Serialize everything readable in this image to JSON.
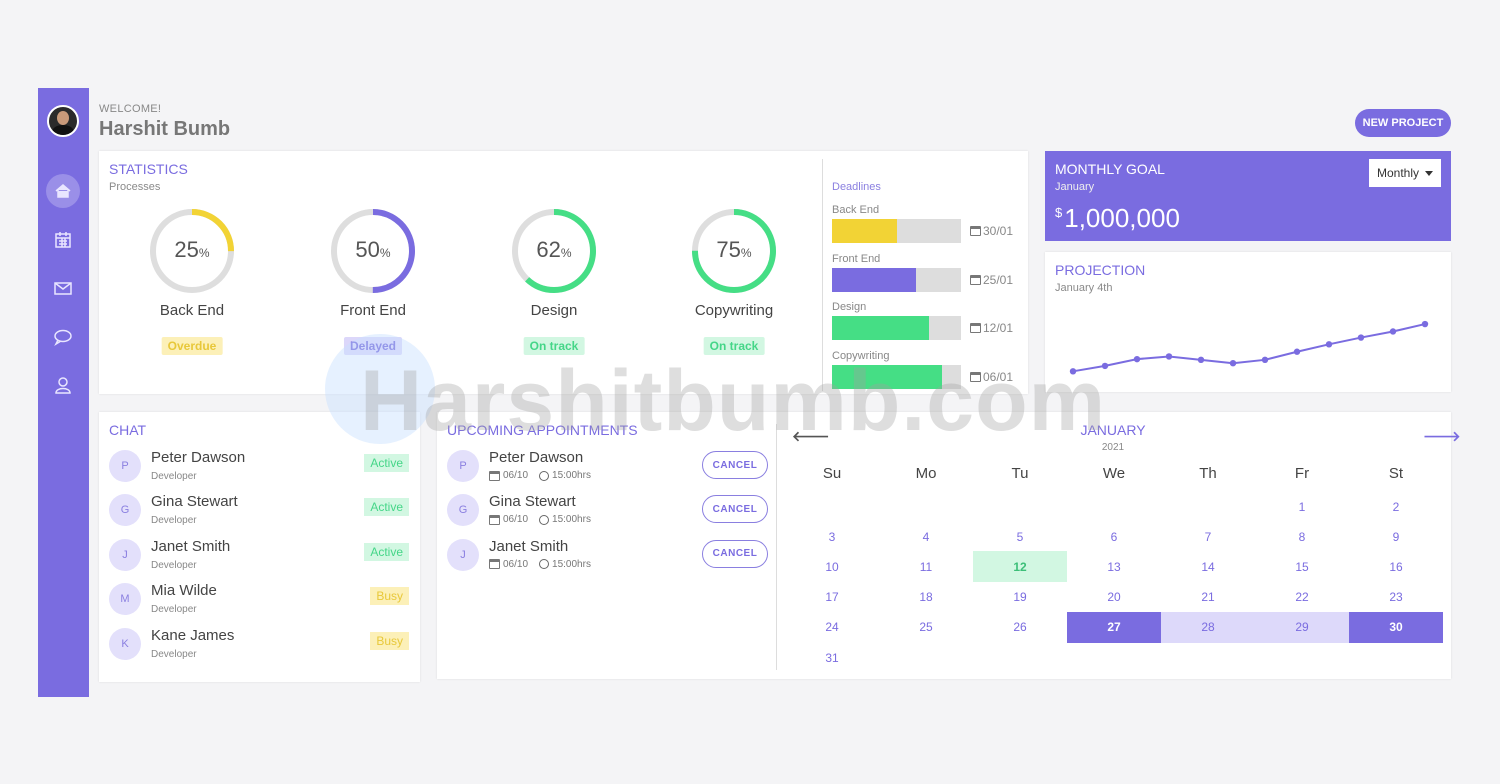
{
  "header": {
    "welcome": "WELCOME!",
    "user_name": "Harshit Bumb",
    "new_project_label": "NEW PROJECT"
  },
  "sidebar": {
    "items": [
      {
        "icon": "home-icon",
        "active": true
      },
      {
        "icon": "calendar-icon"
      },
      {
        "icon": "mail-icon"
      },
      {
        "icon": "chat-icon"
      },
      {
        "icon": "user-icon"
      }
    ]
  },
  "statistics": {
    "title": "STATISTICS",
    "subtitle": "Processes",
    "processes": [
      {
        "name": "Back End",
        "percent": "25",
        "value": 25,
        "status": "Overdue",
        "color": "#f2d335"
      },
      {
        "name": "Front End",
        "percent": "50",
        "value": 50,
        "status": "Delayed",
        "color": "#7a6ce0"
      },
      {
        "name": "Design",
        "percent": "62",
        "value": 62,
        "status": "On track",
        "color": "#45de85"
      },
      {
        "name": "Copywriting",
        "percent": "75",
        "value": 75,
        "status": "On track",
        "color": "#45de85"
      }
    ],
    "percent_sign": "%",
    "deadlines_title": "Deadlines",
    "deadlines": [
      {
        "name": "Back End",
        "progress": 0.5,
        "date": "30/01",
        "color": "#f2d335"
      },
      {
        "name": "Front End",
        "progress": 0.65,
        "date": "25/01",
        "color": "#7a6ce0"
      },
      {
        "name": "Design",
        "progress": 0.75,
        "date": "12/01",
        "color": "#45de85"
      },
      {
        "name": "Copywriting",
        "progress": 0.85,
        "date": "06/01",
        "color": "#45de85"
      }
    ]
  },
  "monthly_goal": {
    "title": "MONTHLY GOAL",
    "subtitle": "January",
    "currency": "$",
    "amount": "1,000,000",
    "select_value": "Monthly"
  },
  "projection": {
    "title": "PROJECTION",
    "subtitle": "January 4th",
    "chart_data": {
      "type": "line",
      "values": [
        4,
        12,
        22,
        26,
        21,
        16,
        21,
        33,
        44,
        54,
        63,
        74
      ]
    }
  },
  "chat": {
    "title": "CHAT",
    "people": [
      {
        "initial": "P",
        "name": "Peter Dawson",
        "role": "Developer",
        "status": "Active"
      },
      {
        "initial": "G",
        "name": "Gina Stewart",
        "role": "Developer",
        "status": "Active"
      },
      {
        "initial": "J",
        "name": "Janet Smith",
        "role": "Developer",
        "status": "Active"
      },
      {
        "initial": "M",
        "name": "Mia Wilde",
        "role": "Developer",
        "status": "Busy"
      },
      {
        "initial": "K",
        "name": "Kane James",
        "role": "Developer",
        "status": "Busy"
      }
    ]
  },
  "appointments": {
    "title": "UPCOMING APPOINTMENTS",
    "cancel_label": "CANCEL",
    "items": [
      {
        "initial": "P",
        "name": "Peter Dawson",
        "date": "06/10",
        "time": "15:00hrs"
      },
      {
        "initial": "G",
        "name": "Gina Stewart",
        "date": "06/10",
        "time": "15:00hrs"
      },
      {
        "initial": "J",
        "name": "Janet Smith",
        "date": "06/10",
        "time": "15:00hrs"
      }
    ]
  },
  "calendar": {
    "month": "JANUARY",
    "year": "2021",
    "prev_arrow": "🡐",
    "next_arrow": "🡒",
    "weekdays": [
      "Su",
      "Mo",
      "Tu",
      "We",
      "Th",
      "Fr",
      "St"
    ],
    "days": [
      "",
      "",
      "",
      "",
      "",
      "1",
      "2",
      "3",
      "4",
      "5",
      "6",
      "7",
      "8",
      "9",
      "10",
      "11",
      "12",
      "13",
      "14",
      "15",
      "16",
      "17",
      "18",
      "19",
      "20",
      "21",
      "22",
      "23",
      "24",
      "25",
      "26",
      "27",
      "28",
      "29",
      "30",
      "31"
    ],
    "today": "12",
    "range_start": "27",
    "range_end": "30"
  },
  "watermark": "Harshitbumb.com"
}
